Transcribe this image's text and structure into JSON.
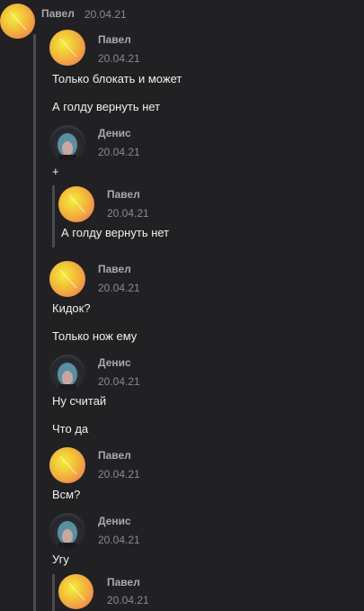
{
  "header": {
    "author": "Павел",
    "date": "20.04.21"
  },
  "messages": [
    {
      "author": "Павел",
      "date": "20.04.21",
      "lines": [
        "Только блокать и может",
        "А голду вернуть нет"
      ]
    },
    {
      "author": "Денис",
      "date": "20.04.21",
      "lines": [
        "+"
      ]
    },
    {
      "author": "Павел",
      "date": "20.04.21",
      "lines": [
        "А голду вернуть нет"
      ]
    },
    {
      "author": "Павел",
      "date": "20.04.21",
      "lines": [
        "Кидок?",
        "Только нож ему"
      ]
    },
    {
      "author": "Денис",
      "date": "20.04.21",
      "lines": [
        "Ну считай",
        "Что да"
      ]
    },
    {
      "author": "Павел",
      "date": "20.04.21",
      "lines": [
        "Всм?"
      ]
    },
    {
      "author": "Денис",
      "date": "20.04.21",
      "lines": [
        "Угу"
      ]
    },
    {
      "author": "Павел",
      "date": "20.04.21",
      "lines": []
    }
  ],
  "icons": {
    "pavel_avatar": "pavel-avatar-icon",
    "denis_avatar": "denis-avatar-icon"
  },
  "colors": {
    "background": "#212124",
    "text": "#f0f0f0",
    "meta": "#8a8a8e",
    "thread_line": "#4a4a4e"
  }
}
